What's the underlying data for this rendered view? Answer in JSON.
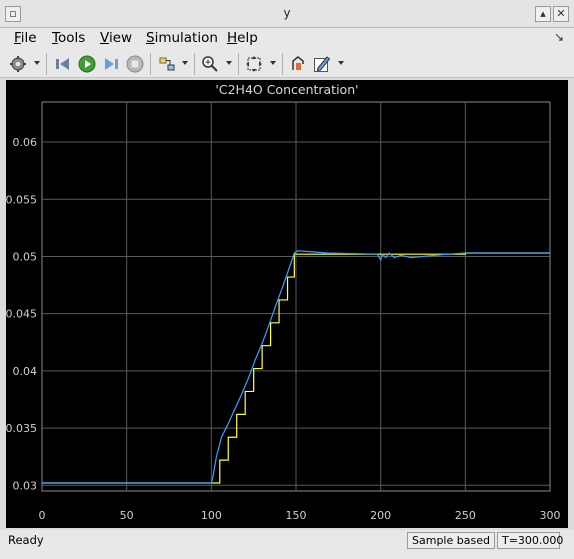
{
  "window": {
    "title": "y"
  },
  "menu": {
    "items": [
      {
        "label": "File",
        "key": "F",
        "rest": "ile"
      },
      {
        "label": "Tools",
        "key": "T",
        "rest": "ools"
      },
      {
        "label": "View",
        "key": "V",
        "rest": "iew"
      },
      {
        "label": "Simulation",
        "key": "S",
        "rest": "imulation"
      },
      {
        "label": "Help",
        "key": "H",
        "rest": "elp"
      }
    ]
  },
  "toolbar": {
    "icons": [
      "gear-icon",
      "step-back-icon",
      "run-icon",
      "step-forward-icon",
      "stop-icon",
      "signal-selector-icon",
      "zoom-icon",
      "autoscale-icon",
      "highlight-block-icon",
      "style-icon"
    ]
  },
  "status": {
    "ready": "Ready",
    "mode": "Sample based",
    "time": "T=300.000"
  },
  "colors": {
    "plot_bg": "#000000",
    "grid": "#5a5a5a",
    "axis_text": "#cfcfcf",
    "series1": "#ffff4d",
    "series2": "#3aa0ff"
  },
  "chart_data": {
    "type": "line",
    "title": "'C2H4O Concentration'",
    "xlim": [
      0,
      300
    ],
    "ylim": [
      0.0295,
      0.0635
    ],
    "xticks": [
      0,
      50,
      100,
      150,
      200,
      250,
      300
    ],
    "yticks": [
      0.03,
      0.035,
      0.04,
      0.045,
      0.05,
      0.055,
      0.06
    ],
    "xtick_labels": [
      "0",
      "50",
      "100",
      "150",
      "200",
      "250",
      "300"
    ],
    "ytick_labels": [
      "0.03",
      "0.035",
      "0.04",
      "0.045",
      "0.05",
      "0.055",
      "0.06"
    ],
    "grid": true,
    "series": [
      {
        "color": "#ffff4d",
        "step": true,
        "x": [
          0,
          101,
          105,
          110,
          115,
          120,
          125,
          130,
          135,
          140,
          145,
          149,
          155,
          205,
          230,
          250,
          300
        ],
        "y": [
          0.0302,
          0.0302,
          0.0322,
          0.0342,
          0.0362,
          0.0382,
          0.0402,
          0.0422,
          0.0442,
          0.0462,
          0.0482,
          0.0502,
          0.0502,
          0.0502,
          0.0502,
          0.0503,
          0.0503
        ]
      },
      {
        "color": "#3aa0ff",
        "step": false,
        "x": [
          0,
          100,
          101,
          103,
          106,
          110,
          114,
          118,
          122,
          126,
          130,
          134,
          138,
          142,
          146,
          149,
          151,
          160,
          168,
          198,
          200,
          201,
          203,
          205,
          208,
          212,
          218,
          225,
          232,
          240,
          250,
          300
        ],
        "y": [
          0.0302,
          0.0302,
          0.0308,
          0.0325,
          0.0342,
          0.0354,
          0.0367,
          0.038,
          0.0394,
          0.041,
          0.0424,
          0.044,
          0.0457,
          0.0473,
          0.049,
          0.0503,
          0.0505,
          0.0504,
          0.0503,
          0.0502,
          0.0497,
          0.0502,
          0.0499,
          0.0503,
          0.0499,
          0.0501,
          0.0499,
          0.05,
          0.0501,
          0.0502,
          0.0503,
          0.0503
        ]
      }
    ]
  }
}
